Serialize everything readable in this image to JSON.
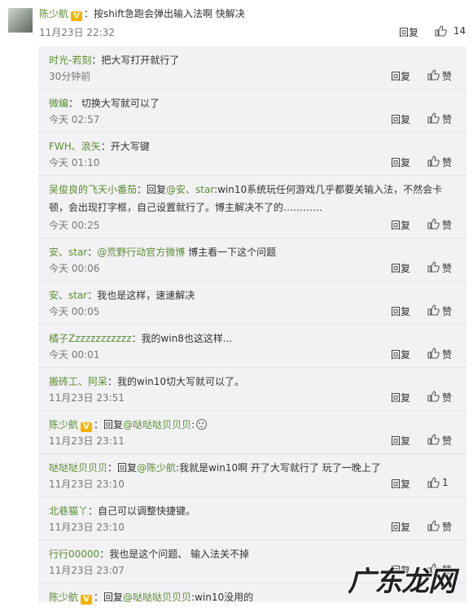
{
  "main_comment": {
    "author": "陈少航",
    "badge": "V",
    "colon": "：",
    "text": "按shift急跑会弹出输入法啊 快解决",
    "time": "11月23日 22:32",
    "reply_label": "回复",
    "like_count": "14"
  },
  "replies": [
    {
      "author": "时光-若刻",
      "text": "：把大写打开就行了",
      "time": "30分钟前",
      "reply_label": "回复",
      "like_label": "赞"
    },
    {
      "author": "微编",
      "text": "： 切换大写就可以了",
      "time": "今天 02:57",
      "reply_label": "回复",
      "like_label": "赞"
    },
    {
      "author": "FWH、浪矢",
      "text": "：开大写键",
      "time": "今天 01:10",
      "reply_label": "回复",
      "like_label": "赞"
    },
    {
      "author": "吴俊良的飞天小番茄",
      "pre": "：回复",
      "mention": "@安、star",
      "text": ":win10系统玩任何游戏几乎都要关输入法，不然会卡顿，会出现打字框，自己设置就行了。博主解决不了的…………",
      "time": "今天 00:25",
      "reply_label": "回复",
      "like_label": "赞"
    },
    {
      "author": "安、star",
      "pre": "：",
      "mention": "@荒野行动官方微博",
      "text": " 博主看一下这个问题",
      "time": "今天 00:06",
      "reply_label": "回复",
      "like_label": "赞"
    },
    {
      "author": "安、star",
      "text": "：我也是这样，速速解决",
      "time": "今天 00:05",
      "reply_label": "回复",
      "like_label": "赞"
    },
    {
      "author": "橘子Zzzzzzzzzzzz",
      "text": "：我的win8也这这样...",
      "time": "今天 00:01",
      "reply_label": "回复",
      "like_label": "赞"
    },
    {
      "author": "搬砖工、阿呆",
      "text": "：我的win10切大写就可以了。",
      "time": "11月23日 23:51",
      "reply_label": "回复",
      "like_label": "赞"
    },
    {
      "author": "陈少航",
      "badge": "V",
      "pre": "：回复",
      "mention": "@哒哒哒贝贝贝",
      "text": ":",
      "time": "11月23日 23:11",
      "reply_label": "回复",
      "like_label": "赞"
    },
    {
      "author": "哒哒哒贝贝贝",
      "pre": "：回复",
      "mention": "@陈少航",
      "text": ":我就是win10啊 开了大写就行了 玩了一晚上了",
      "time": "11月23日 23:10",
      "reply_label": "回复",
      "like_label": "1"
    },
    {
      "author": "北巷猫丫",
      "text": "：自己可以调整快捷键。",
      "time": "11月23日 23:10",
      "reply_label": "回复",
      "like_label": "赞"
    },
    {
      "author": "行行00000",
      "text": "：我也是这个问题、 输入法关不掉",
      "time": "11月23日 23:07",
      "reply_label": "回复",
      "like_label": "赞"
    },
    {
      "author": "陈少航",
      "badge": "V",
      "pre": "：回复",
      "mention": "@哒哒哒贝贝贝",
      "text": ":win10没用的",
      "time": "",
      "reply_label": "",
      "like_label": ""
    }
  ],
  "watermark": "广东龙网",
  "colors": {
    "link": "#5a8f2f",
    "badge": "#f5b400",
    "panel": "#f2f2f5"
  }
}
